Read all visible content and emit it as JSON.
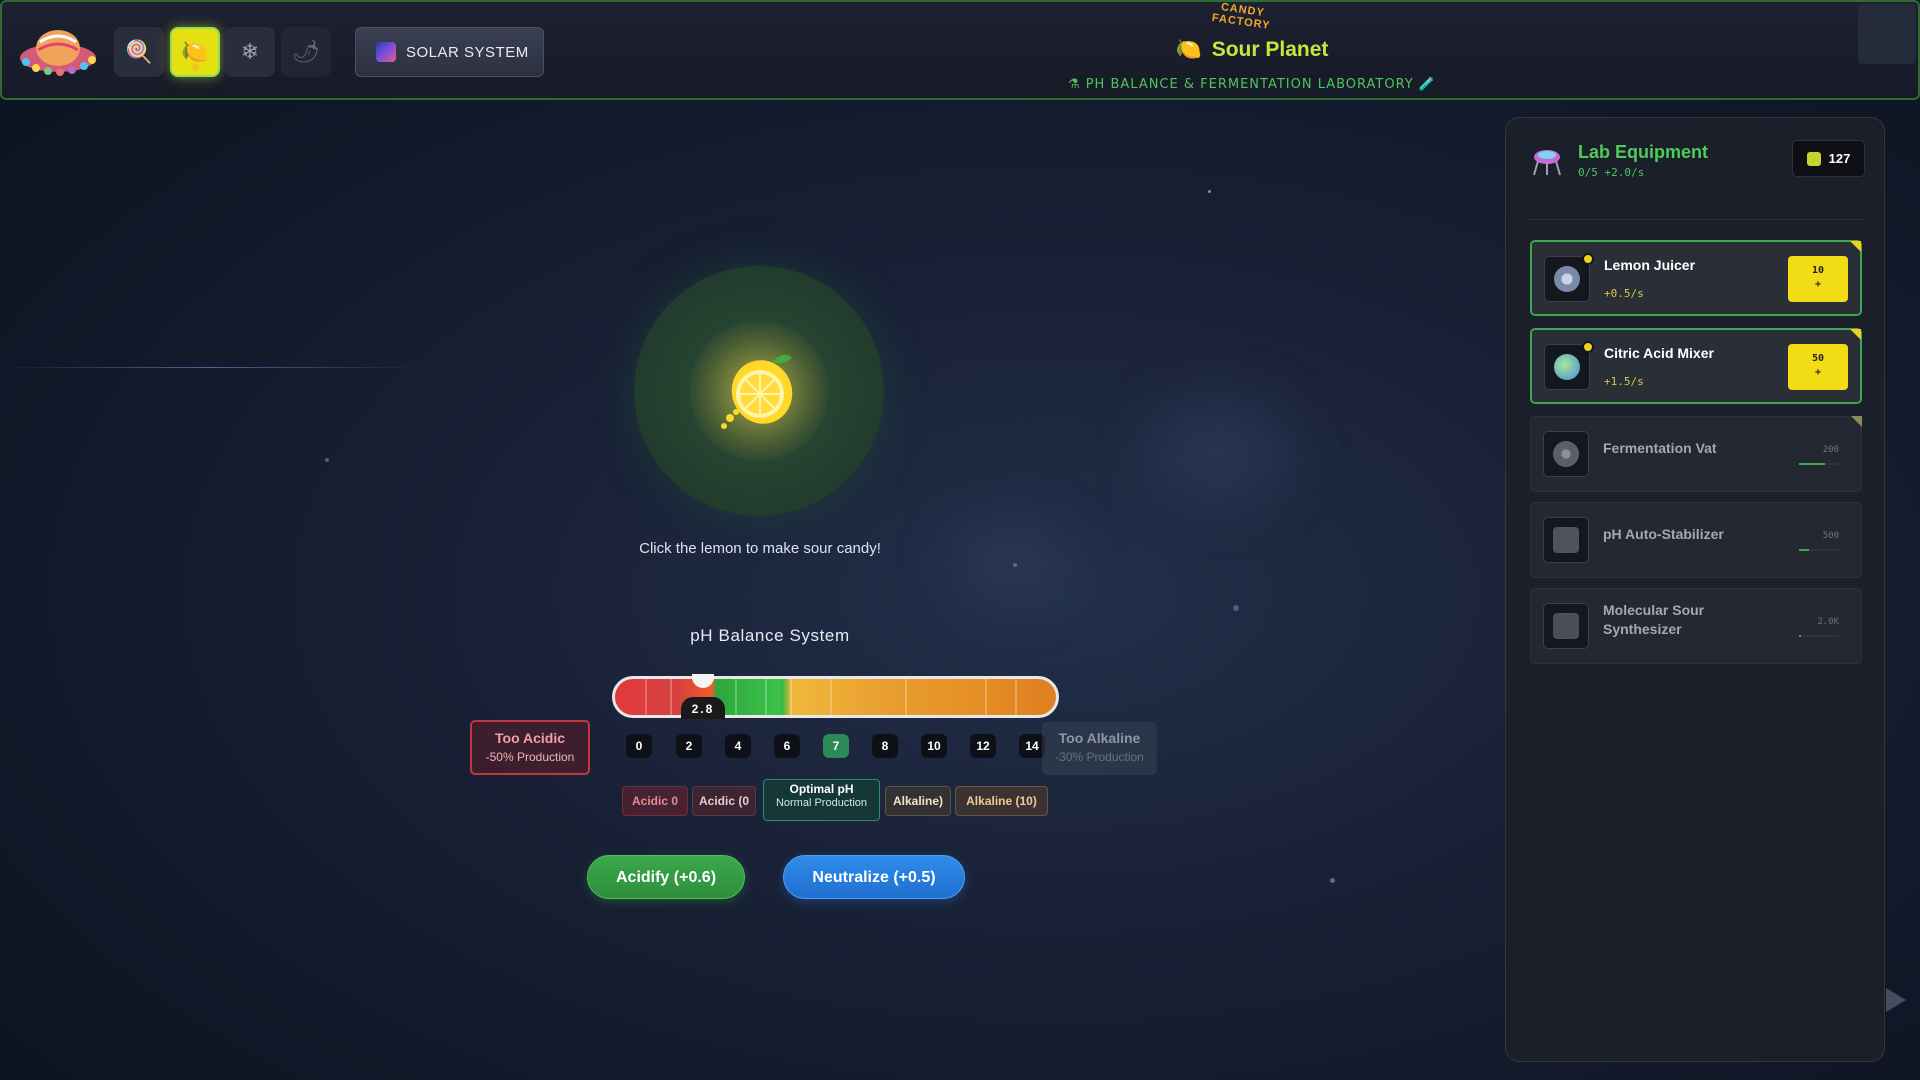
{
  "header": {
    "factory_badge": "CANDY FACTORY",
    "planet_title": "Sour Planet",
    "lab_subtitle": "PH BALANCE & FERMENTATION LABORATORY",
    "solar_button": "SOLAR SYSTEM",
    "planets": [
      {
        "icon": "lollipop-icon",
        "glyph": "🍭",
        "active": false
      },
      {
        "icon": "lemon-icon",
        "glyph": "🍋",
        "active": true
      },
      {
        "icon": "snowflake-icon",
        "glyph": "❄",
        "active": false
      },
      {
        "icon": "chili-icon",
        "glyph": "🌶",
        "active": false
      }
    ]
  },
  "main": {
    "instruction": "Click the lemon to make sour candy!",
    "ph": {
      "title": "pH Balance System",
      "value_label": "2.8",
      "value": 2.8,
      "min": 0,
      "max": 14,
      "ticks": [
        "0",
        "2",
        "4",
        "6",
        "7",
        "8",
        "10",
        "12",
        "14"
      ],
      "active_tick": "7",
      "too_acidic": {
        "title": "Too Acidic",
        "effect": "-50% Production"
      },
      "too_alkaline": {
        "title": "Too Alkaline",
        "effect": "-30% Production"
      },
      "zones": [
        {
          "label": "Acidic 0",
          "kind": "acid"
        },
        {
          "label": "Acidic (0",
          "kind": "acid2"
        },
        {
          "label": "Optimal pH",
          "sub": "Normal Production",
          "kind": "opt"
        },
        {
          "label": "Alkaline)",
          "kind": "alk"
        },
        {
          "label": "Alkaline (10)",
          "kind": "alk2"
        }
      ]
    },
    "buttons": {
      "acidify": "Acidify (+0.6)",
      "neutralize": "Neutralize (+0.5)"
    }
  },
  "panel": {
    "title": "Lab Equipment",
    "stats": "0/5  +2.0/s",
    "coins": "127",
    "equipment": [
      {
        "name": "Lemon Juicer",
        "rate": "+0.5/s",
        "cost": "10",
        "buy_suffix": "+",
        "state": "available",
        "icon_color": "#8a9ab8"
      },
      {
        "name": "Citric Acid Mixer",
        "rate": "+1.5/s",
        "cost": "50",
        "buy_suffix": "+",
        "state": "available",
        "icon_color": "#57b85a"
      },
      {
        "name": "Fermentation Vat",
        "cost": "200",
        "progress": 0.64,
        "state": "locked",
        "icon_color": "#6a6f7a"
      },
      {
        "name": "pH Auto-Stabilizer",
        "cost": "500",
        "progress": 0.26,
        "state": "locked",
        "icon_color": "#4e535d"
      },
      {
        "name": "Molecular Sour Synthesizer",
        "cost": "2.0K",
        "progress": 0.06,
        "state": "locked",
        "icon_color": "#4a4f58"
      }
    ]
  },
  "colors": {
    "accent_green": "#4ccd5a",
    "accent_yellow": "#f2dc16",
    "acidify": "#3aa84a",
    "neutralize": "#2f8ce8"
  }
}
